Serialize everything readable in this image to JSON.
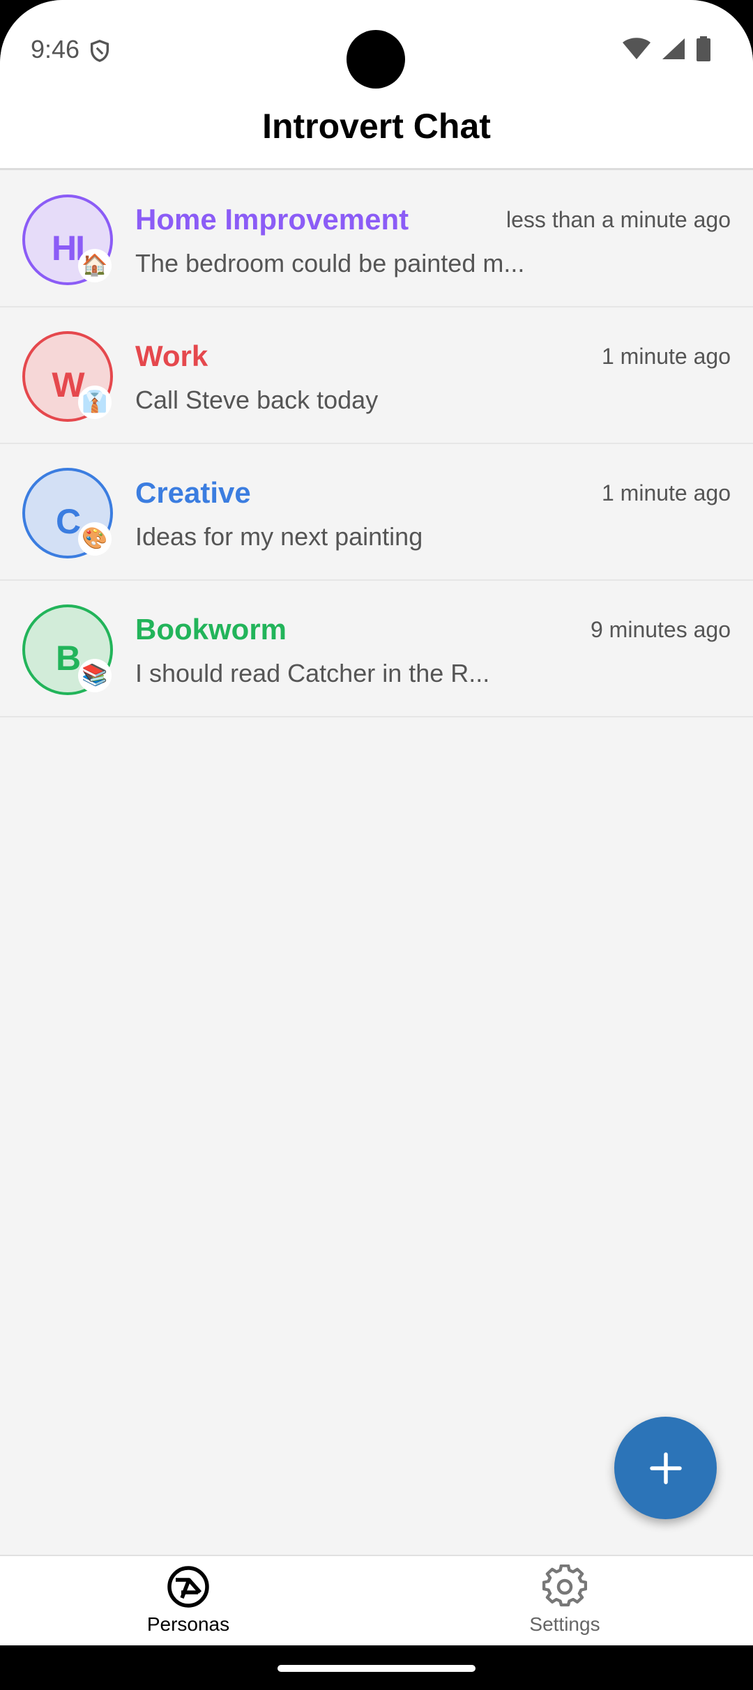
{
  "status_bar": {
    "time": "9:46",
    "icons": [
      "shield-icon",
      "wifi-icon",
      "signal-icon",
      "battery-icon"
    ]
  },
  "app_bar": {
    "title": "Introvert Chat"
  },
  "personas": [
    {
      "initials": "HI",
      "emoji": "🏠",
      "name": "Home Improvement",
      "time": "less than a minute ago",
      "message": "The bedroom could be painted m...",
      "color": "#8b5cf6",
      "bg": "#e6dcf9"
    },
    {
      "initials": "W",
      "emoji": "👔",
      "name": "Work",
      "time": "1 minute ago",
      "message": "Call Steve back today",
      "color": "#e5484d",
      "bg": "#f6d7d7"
    },
    {
      "initials": "C",
      "emoji": "🎨",
      "name": "Creative",
      "time": "1 minute ago",
      "message": "Ideas for my next painting",
      "color": "#3b7de0",
      "bg": "#d3e0f5"
    },
    {
      "initials": "B",
      "emoji": "📚",
      "name": "Bookworm",
      "time": "9 minutes ago",
      "message": "I should read Catcher in the R...",
      "color": "#22b45a",
      "bg": "#d2ecd9"
    }
  ],
  "fab": {
    "icon": "plus-icon",
    "color": "#2c74b8"
  },
  "bottom_nav": {
    "items": [
      {
        "label": "Personas",
        "icon": "personas-icon",
        "active": true
      },
      {
        "label": "Settings",
        "icon": "gear-icon",
        "active": false
      }
    ]
  }
}
